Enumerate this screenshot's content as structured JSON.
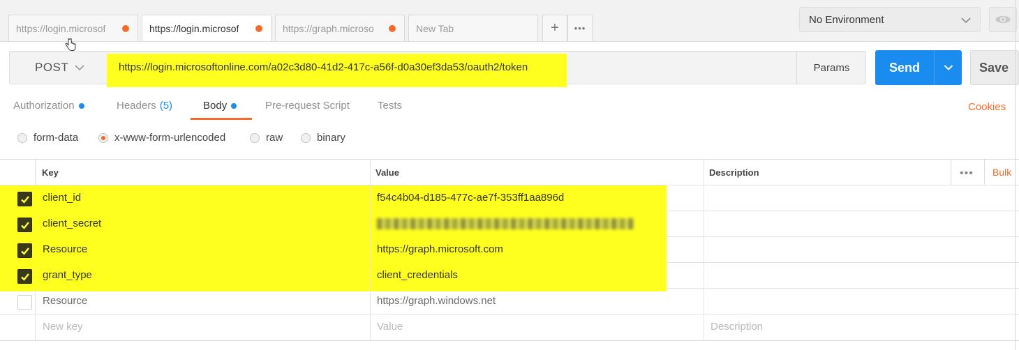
{
  "tabs": [
    {
      "label": "https://login.microsof",
      "active": false,
      "unsaved": true
    },
    {
      "label": "https://login.microsof",
      "active": true,
      "unsaved": true
    },
    {
      "label": "https://graph.microso",
      "active": false,
      "unsaved": true
    },
    {
      "label": "New Tab",
      "active": false,
      "unsaved": false
    }
  ],
  "tab_actions": {
    "add": "+",
    "more": "•••"
  },
  "environment": {
    "selected": "No Environment"
  },
  "request": {
    "method": "POST",
    "url": "https://login.microsoftonline.com/a02c3d80-41d2-417c-a56f-d0a30ef3da53/oauth2/token",
    "params_label": "Params",
    "send_label": "Send",
    "save_label": "Save"
  },
  "subtabs": [
    {
      "label": "Authorization",
      "dot": true
    },
    {
      "label": "Headers",
      "count": "(5)"
    },
    {
      "label": "Body",
      "dot": true,
      "active": true
    },
    {
      "label": "Pre-request Script"
    },
    {
      "label": "Tests"
    }
  ],
  "cookies_label": "Cookies",
  "body_types": [
    {
      "label": "form-data",
      "selected": false
    },
    {
      "label": "x-www-form-urlencoded",
      "selected": true
    },
    {
      "label": "raw",
      "selected": false
    },
    {
      "label": "binary",
      "selected": false
    }
  ],
  "table": {
    "headers": {
      "key": "Key",
      "value": "Value",
      "description": "Description"
    },
    "more": "•••",
    "bulk_edit": "Bulk",
    "rows": [
      {
        "checked": true,
        "key": "client_id",
        "value": "f54c4b04-d185-477c-ae7f-353ff1aa896d",
        "highlighted": true
      },
      {
        "checked": true,
        "key": "client_secret",
        "value": "",
        "redacted": true,
        "highlighted": true
      },
      {
        "checked": true,
        "key": "Resource",
        "value": "https://graph.microsoft.com",
        "highlighted": true
      },
      {
        "checked": true,
        "key": "grant_type",
        "value": "client_credentials",
        "highlighted": true
      },
      {
        "checked": false,
        "key": "Resource",
        "value": "https://graph.windows.net",
        "highlighted": false
      }
    ],
    "new_row": {
      "key_placeholder": "New key",
      "value_placeholder": "Value",
      "description_placeholder": "Description"
    }
  },
  "colors": {
    "accent": "#f26b2a",
    "send": "#1a8cf0",
    "highlight": "#ffff1f"
  }
}
